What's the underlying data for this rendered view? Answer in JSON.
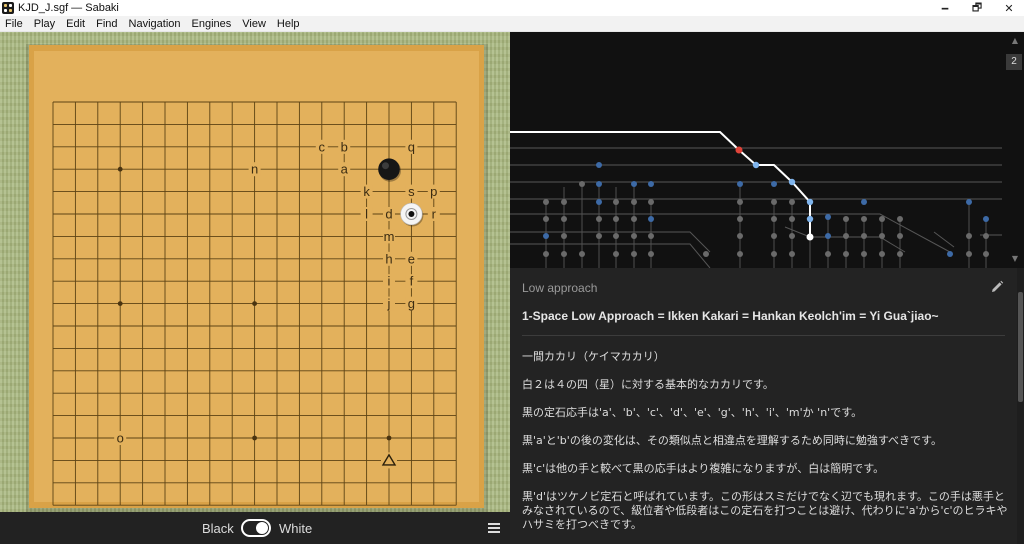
{
  "window": {
    "title": "KJD_J.sgf — Sabaki",
    "minimize": "🗕",
    "maximize": "🗗",
    "close": "✕"
  },
  "menu": [
    "File",
    "Play",
    "Edit",
    "Find",
    "Navigation",
    "Engines",
    "View",
    "Help"
  ],
  "board": {
    "size": 19,
    "hoshi": [
      [
        3,
        3
      ],
      [
        9,
        3
      ],
      [
        15,
        3
      ],
      [
        3,
        9
      ],
      [
        9,
        9
      ],
      [
        15,
        9
      ],
      [
        3,
        15
      ],
      [
        9,
        15
      ],
      [
        15,
        15
      ]
    ],
    "stones": [
      {
        "color": "black",
        "col": 15,
        "row": 3
      },
      {
        "color": "white",
        "col": 16,
        "row": 5,
        "current": true
      }
    ],
    "labels": [
      {
        "text": "c",
        "col": 12,
        "row": 2
      },
      {
        "text": "b",
        "col": 13,
        "row": 2
      },
      {
        "text": "q",
        "col": 16,
        "row": 2
      },
      {
        "text": "n",
        "col": 9,
        "row": 3
      },
      {
        "text": "a",
        "col": 13,
        "row": 3
      },
      {
        "text": "k",
        "col": 14,
        "row": 4
      },
      {
        "text": "s",
        "col": 16,
        "row": 4
      },
      {
        "text": "p",
        "col": 17,
        "row": 4
      },
      {
        "text": "l",
        "col": 14,
        "row": 5
      },
      {
        "text": "d",
        "col": 15,
        "row": 5
      },
      {
        "text": "r",
        "col": 17,
        "row": 5
      },
      {
        "text": "m",
        "col": 15,
        "row": 6
      },
      {
        "text": "h",
        "col": 15,
        "row": 7
      },
      {
        "text": "e",
        "col": 16,
        "row": 7
      },
      {
        "text": "i",
        "col": 15,
        "row": 8
      },
      {
        "text": "f",
        "col": 16,
        "row": 8
      },
      {
        "text": "j",
        "col": 15,
        "row": 9
      },
      {
        "text": "g",
        "col": 16,
        "row": 9
      },
      {
        "text": "o",
        "col": 3,
        "row": 15
      }
    ],
    "triangle": {
      "col": 15,
      "row": 16
    }
  },
  "bottombar": {
    "black_label": "Black",
    "white_label": "White",
    "toggle_state": "White"
  },
  "tree": {
    "move_number": "2",
    "scroll_up": "▲",
    "scroll_down": "▼"
  },
  "comment": {
    "title": "Low approach",
    "heading": "1-Space Low Approach = Ikken Kakari = Hankan Keolch'im = Yi Gua`jiao~",
    "lines": [
      "一間カカリ（ケイマカカリ）",
      "白２は４の四（星）に対する基本的なカカリです。",
      "黒の定石応手は'a'、'b'、'c'、'd'、'e'、'g'、'h'、'i'、'm'か 'n'です。",
      "黒'a'と'b'の後の変化は、その類似点と相違点を理解するため同時に勉強すべきです。",
      "黒'c'は他の手と較べて黒の応手はより複雑になりますが、白は簡明です。",
      "黒'd'はツケノビ定石と呼ばれています。この形はスミだけでなく辺でも現れます。この手は悪手とみなされているので、級位者や低段者はこの定石を打つことは避け、代わりに'a'から'c'のヒラキやハサミを打つべきです。"
    ]
  },
  "colors": {
    "board": "#e3b15c",
    "board_frame": "#d9a247",
    "sidebar": "#191919",
    "tree_bg": "#111111",
    "accent": "#4a90e2",
    "current_node": "#e0443a"
  }
}
